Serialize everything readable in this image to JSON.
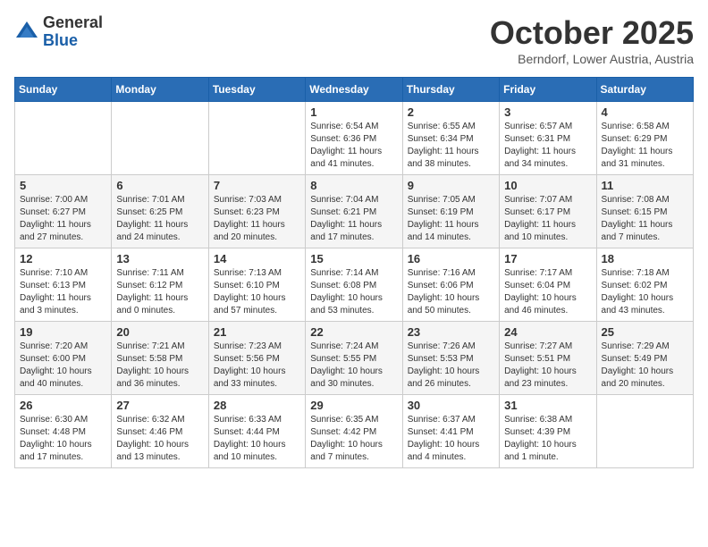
{
  "logo": {
    "general": "General",
    "blue": "Blue"
  },
  "header": {
    "month": "October 2025",
    "location": "Berndorf, Lower Austria, Austria"
  },
  "weekdays": [
    "Sunday",
    "Monday",
    "Tuesday",
    "Wednesday",
    "Thursday",
    "Friday",
    "Saturday"
  ],
  "weeks": [
    [
      {
        "day": "",
        "info": ""
      },
      {
        "day": "",
        "info": ""
      },
      {
        "day": "",
        "info": ""
      },
      {
        "day": "1",
        "info": "Sunrise: 6:54 AM\nSunset: 6:36 PM\nDaylight: 11 hours\nand 41 minutes."
      },
      {
        "day": "2",
        "info": "Sunrise: 6:55 AM\nSunset: 6:34 PM\nDaylight: 11 hours\nand 38 minutes."
      },
      {
        "day": "3",
        "info": "Sunrise: 6:57 AM\nSunset: 6:31 PM\nDaylight: 11 hours\nand 34 minutes."
      },
      {
        "day": "4",
        "info": "Sunrise: 6:58 AM\nSunset: 6:29 PM\nDaylight: 11 hours\nand 31 minutes."
      }
    ],
    [
      {
        "day": "5",
        "info": "Sunrise: 7:00 AM\nSunset: 6:27 PM\nDaylight: 11 hours\nand 27 minutes."
      },
      {
        "day": "6",
        "info": "Sunrise: 7:01 AM\nSunset: 6:25 PM\nDaylight: 11 hours\nand 24 minutes."
      },
      {
        "day": "7",
        "info": "Sunrise: 7:03 AM\nSunset: 6:23 PM\nDaylight: 11 hours\nand 20 minutes."
      },
      {
        "day": "8",
        "info": "Sunrise: 7:04 AM\nSunset: 6:21 PM\nDaylight: 11 hours\nand 17 minutes."
      },
      {
        "day": "9",
        "info": "Sunrise: 7:05 AM\nSunset: 6:19 PM\nDaylight: 11 hours\nand 14 minutes."
      },
      {
        "day": "10",
        "info": "Sunrise: 7:07 AM\nSunset: 6:17 PM\nDaylight: 11 hours\nand 10 minutes."
      },
      {
        "day": "11",
        "info": "Sunrise: 7:08 AM\nSunset: 6:15 PM\nDaylight: 11 hours\nand 7 minutes."
      }
    ],
    [
      {
        "day": "12",
        "info": "Sunrise: 7:10 AM\nSunset: 6:13 PM\nDaylight: 11 hours\nand 3 minutes."
      },
      {
        "day": "13",
        "info": "Sunrise: 7:11 AM\nSunset: 6:12 PM\nDaylight: 11 hours\nand 0 minutes."
      },
      {
        "day": "14",
        "info": "Sunrise: 7:13 AM\nSunset: 6:10 PM\nDaylight: 10 hours\nand 57 minutes."
      },
      {
        "day": "15",
        "info": "Sunrise: 7:14 AM\nSunset: 6:08 PM\nDaylight: 10 hours\nand 53 minutes."
      },
      {
        "day": "16",
        "info": "Sunrise: 7:16 AM\nSunset: 6:06 PM\nDaylight: 10 hours\nand 50 minutes."
      },
      {
        "day": "17",
        "info": "Sunrise: 7:17 AM\nSunset: 6:04 PM\nDaylight: 10 hours\nand 46 minutes."
      },
      {
        "day": "18",
        "info": "Sunrise: 7:18 AM\nSunset: 6:02 PM\nDaylight: 10 hours\nand 43 minutes."
      }
    ],
    [
      {
        "day": "19",
        "info": "Sunrise: 7:20 AM\nSunset: 6:00 PM\nDaylight: 10 hours\nand 40 minutes."
      },
      {
        "day": "20",
        "info": "Sunrise: 7:21 AM\nSunset: 5:58 PM\nDaylight: 10 hours\nand 36 minutes."
      },
      {
        "day": "21",
        "info": "Sunrise: 7:23 AM\nSunset: 5:56 PM\nDaylight: 10 hours\nand 33 minutes."
      },
      {
        "day": "22",
        "info": "Sunrise: 7:24 AM\nSunset: 5:55 PM\nDaylight: 10 hours\nand 30 minutes."
      },
      {
        "day": "23",
        "info": "Sunrise: 7:26 AM\nSunset: 5:53 PM\nDaylight: 10 hours\nand 26 minutes."
      },
      {
        "day": "24",
        "info": "Sunrise: 7:27 AM\nSunset: 5:51 PM\nDaylight: 10 hours\nand 23 minutes."
      },
      {
        "day": "25",
        "info": "Sunrise: 7:29 AM\nSunset: 5:49 PM\nDaylight: 10 hours\nand 20 minutes."
      }
    ],
    [
      {
        "day": "26",
        "info": "Sunrise: 6:30 AM\nSunset: 4:48 PM\nDaylight: 10 hours\nand 17 minutes."
      },
      {
        "day": "27",
        "info": "Sunrise: 6:32 AM\nSunset: 4:46 PM\nDaylight: 10 hours\nand 13 minutes."
      },
      {
        "day": "28",
        "info": "Sunrise: 6:33 AM\nSunset: 4:44 PM\nDaylight: 10 hours\nand 10 minutes."
      },
      {
        "day": "29",
        "info": "Sunrise: 6:35 AM\nSunset: 4:42 PM\nDaylight: 10 hours\nand 7 minutes."
      },
      {
        "day": "30",
        "info": "Sunrise: 6:37 AM\nSunset: 4:41 PM\nDaylight: 10 hours\nand 4 minutes."
      },
      {
        "day": "31",
        "info": "Sunrise: 6:38 AM\nSunset: 4:39 PM\nDaylight: 10 hours\nand 1 minute."
      },
      {
        "day": "",
        "info": ""
      }
    ]
  ]
}
